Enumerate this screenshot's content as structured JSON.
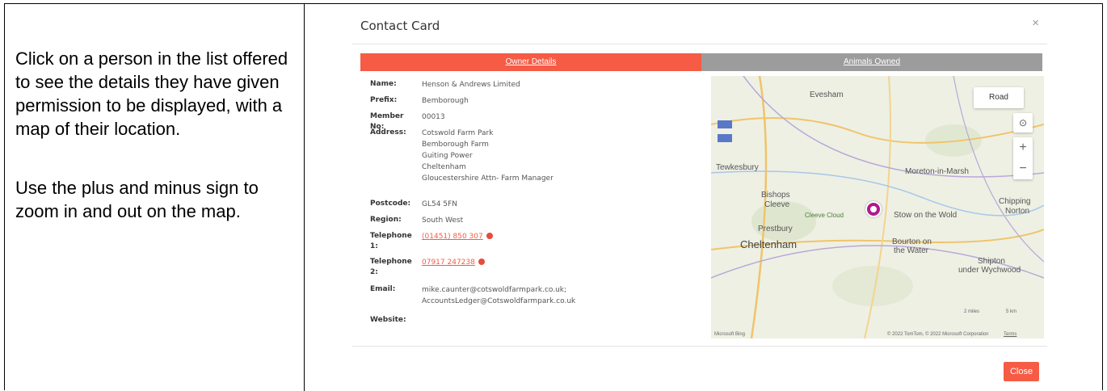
{
  "instructions": {
    "p1": "Click on a person in the list offered to see the details they have given permission to be displayed, with a map of their location.",
    "p2": "Use the plus and minus sign to zoom in and out on the map."
  },
  "modal": {
    "title": "Contact Card",
    "close_x": "×",
    "tabs": {
      "owner": "Owner Details",
      "animals": "Animals Owned"
    },
    "close_label": "Close",
    "accent_color": "#f65b45"
  },
  "details": {
    "name_label": "Name:",
    "name_value": "Henson & Andrews Limited",
    "prefix_label": "Prefix:",
    "prefix_value": "Bemborough",
    "member_label": "Member No:",
    "member_value": "00013",
    "address_label": "Address:",
    "address_lines": [
      "Cotswold Farm Park",
      "Bemborough Farm",
      "Guiting Power",
      "Cheltenham",
      "Gloucestershire Attn- Farm Manager"
    ],
    "postcode_label": "Postcode:",
    "postcode_value": "GL54 5FN",
    "region_label": "Region:",
    "region_value": "South West",
    "tel1_label": "Telephone 1:",
    "tel1_value": "(01451) 850 307",
    "tel2_label": "Telephone 2:",
    "tel2_value": "07917 247238",
    "email_label": "Email:",
    "email_lines": [
      "mike.caunter@cotswoldfarmpark.co.uk;",
      "AccountsLedger@Cotswoldfarmpark.co.uk"
    ],
    "website_label": "Website:"
  },
  "map": {
    "road_label": "Road",
    "locate_icon": "⊙",
    "zoom_in": "+",
    "zoom_out": "−",
    "places": {
      "evesham": "Evesham",
      "tewkesbury": "Tewkesbury",
      "moreton": "Moreton-in-Marsh",
      "bishops": "Bishops",
      "cleeve": "Cleeve",
      "cleeve_cloud": "Cleeve Cloud",
      "stow": "Stow on the Wold",
      "chipping": "Chipping",
      "norton": "Norton",
      "prestbury": "Prestbury",
      "cheltenham": "Cheltenham",
      "bourton": "Bourton on",
      "water": "the Water",
      "shipton": "Shipton",
      "wychwood": "under Wychwood"
    },
    "scale_miles": "2 miles",
    "scale_km": "5 km",
    "attribution": "© 2022 TomTom, © 2022 Microsoft Corporation",
    "terms": "Terms",
    "bing": "Microsoft Bing"
  }
}
